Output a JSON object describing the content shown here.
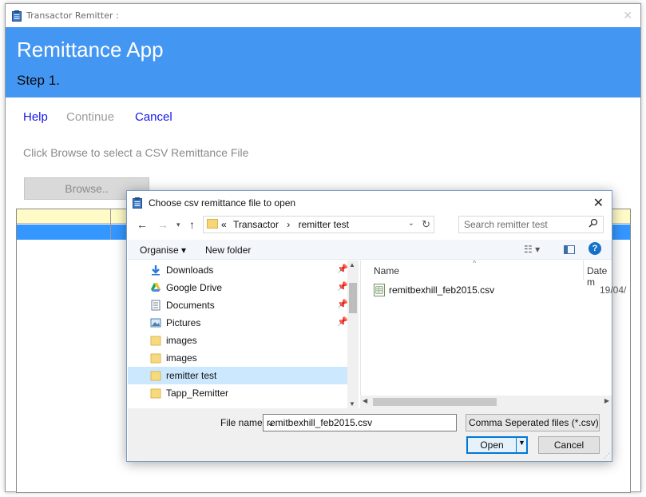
{
  "window": {
    "title": "Transactor Remitter :"
  },
  "header": {
    "app_title": "Remittance App",
    "step": "Step 1."
  },
  "nav": {
    "help": "Help",
    "continue": "Continue",
    "cancel": "Cancel"
  },
  "instruction": "Click Browse to select a CSV Remittance File",
  "browse_button": "Browse..",
  "dialog": {
    "title": "Choose csv remittance file to open",
    "address": {
      "prefix": "«",
      "segment1": "Transactor",
      "separator": "›",
      "segment2": "remitter test"
    },
    "search_placeholder": "Search remitter test",
    "toolbar": {
      "organise": "Organise ▾",
      "new_folder": "New folder",
      "help": "?"
    },
    "nav_items": [
      {
        "label": "Downloads",
        "icon": "download-icon",
        "pinned": true
      },
      {
        "label": "Google Drive",
        "icon": "google-drive-icon",
        "pinned": true
      },
      {
        "label": "Documents",
        "icon": "documents-icon",
        "pinned": true
      },
      {
        "label": "Pictures",
        "icon": "pictures-icon",
        "pinned": true
      },
      {
        "label": "images",
        "icon": "folder-icon",
        "pinned": false
      },
      {
        "label": "images",
        "icon": "folder-icon",
        "pinned": false
      },
      {
        "label": "remitter test",
        "icon": "folder-icon",
        "pinned": false,
        "selected": true
      },
      {
        "label": "Tapp_Remitter",
        "icon": "folder-icon",
        "pinned": false
      }
    ],
    "columns": {
      "name": "Name",
      "date": "Date m"
    },
    "files": [
      {
        "name": "remitbexhill_feb2015.csv",
        "date": "19/04/"
      }
    ],
    "file_name_label": "File name:",
    "file_name_value": "remitbexhill_feb2015.csv",
    "file_type": "Comma Seperated files (*.csv)",
    "open_button": "Open",
    "cancel_button": "Cancel"
  },
  "colors": {
    "header_blue": "#4496f3",
    "link_blue": "#1418e8",
    "grid_header_yellow": "#fffbc6",
    "selected_row": "#3397ff"
  }
}
